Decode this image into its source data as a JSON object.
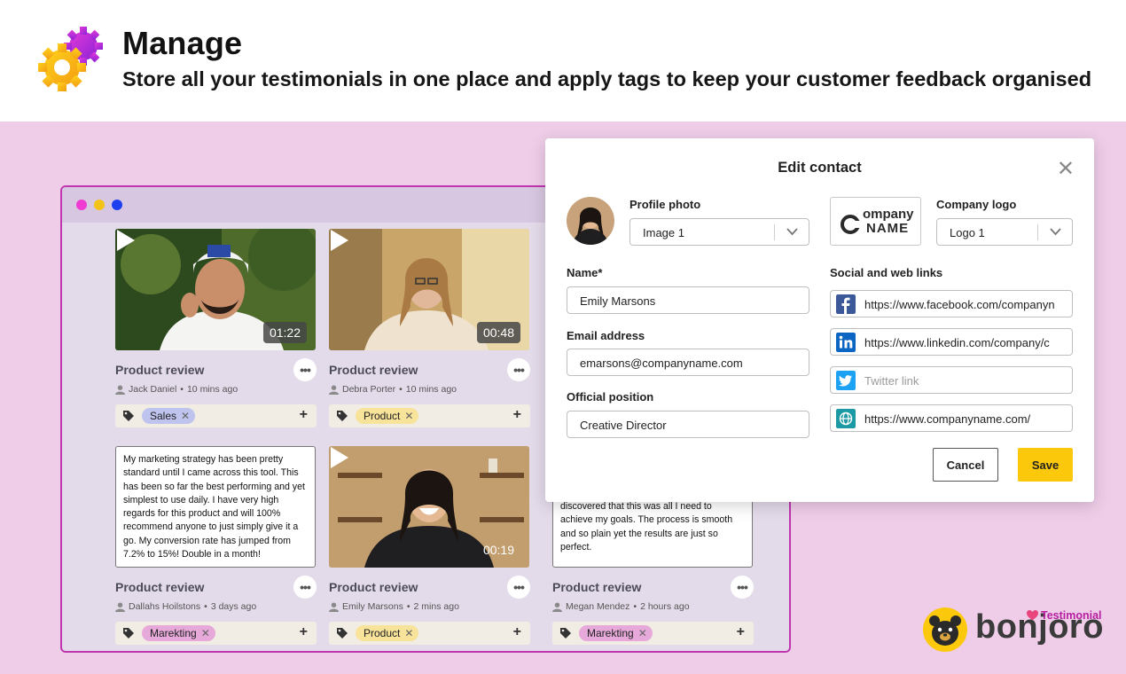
{
  "header": {
    "title": "Manage",
    "subtitle": "Store all your testimonials in one place and apply tags to keep your customer feedback organised",
    "icon": "gears-icon"
  },
  "colors": {
    "background": "#efcde8",
    "window_border": "#c035b0",
    "save_button": "#fcc80b",
    "tag_sales": "#bfc4ee",
    "tag_product": "#f8e39a",
    "tag_marketing": "#e7a9d9"
  },
  "cards": [
    {
      "kind": "video",
      "duration": "01:22",
      "title": "Product review",
      "author": "Jack Daniel",
      "time": "10 mins ago",
      "tag": "Sales",
      "tag_color": "#bfc4ee"
    },
    {
      "kind": "video",
      "duration": "00:48",
      "title": "Product review",
      "author": "Debra Porter",
      "time": "10 mins ago",
      "tag": "Product",
      "tag_color": "#f8e39a"
    },
    {
      "kind": "text",
      "text": "My marketing strategy has been pretty standard until I came across this tool. This has been so far the best performing and yet simplest to use daily. I have very high regards for this product and will 100% recommend anyone to just simply give it a go. My conversion rate has jumped from 7.2% to 15%! Double in a month!",
      "title": "Product review",
      "author": "Dallahs Hoilstons",
      "time": "3 days ago",
      "tag": "Marekting",
      "tag_color": "#e7a9d9"
    },
    {
      "kind": "video",
      "duration": "00:19",
      "title": "Product review",
      "author": "Emily Marsons",
      "time": "2 mins ago",
      "tag": "Product",
      "tag_color": "#f8e39a"
    },
    {
      "kind": "text",
      "text": "discovered that this was all I need to achieve my goals. The process is smooth and so plain yet the results are just so perfect.",
      "title": "Product review",
      "author": "Megan Mendez",
      "time": "2 hours ago",
      "tag": "Marekting",
      "tag_color": "#e7a9d9"
    }
  ],
  "modal": {
    "title": "Edit contact",
    "profile_photo_label": "Profile photo",
    "profile_photo_value": "Image 1",
    "company_logo_label": "Company logo",
    "company_logo_value": "Logo 1",
    "logo_text_top": "ompany",
    "logo_text_bottom": "NAME",
    "name_label": "Name*",
    "name_value": "Emily Marsons",
    "email_label": "Email address",
    "email_value": "emarsons@companyname.com",
    "position_label": "Official position",
    "position_value": "Creative Director",
    "links_label": "Social and web links",
    "links": [
      {
        "icon": "facebook-icon",
        "value": "https://www.facebook.com/companyn"
      },
      {
        "icon": "linkedin-icon",
        "value": "https://www.linkedin.com/company/c"
      },
      {
        "icon": "twitter-icon",
        "value": "",
        "placeholder": "Twitter link"
      },
      {
        "icon": "globe-icon",
        "value": "https://www.companyname.com/"
      }
    ],
    "cancel_label": "Cancel",
    "save_label": "Save"
  },
  "brand": {
    "name": "bonjoro",
    "product": "Testimonial"
  }
}
